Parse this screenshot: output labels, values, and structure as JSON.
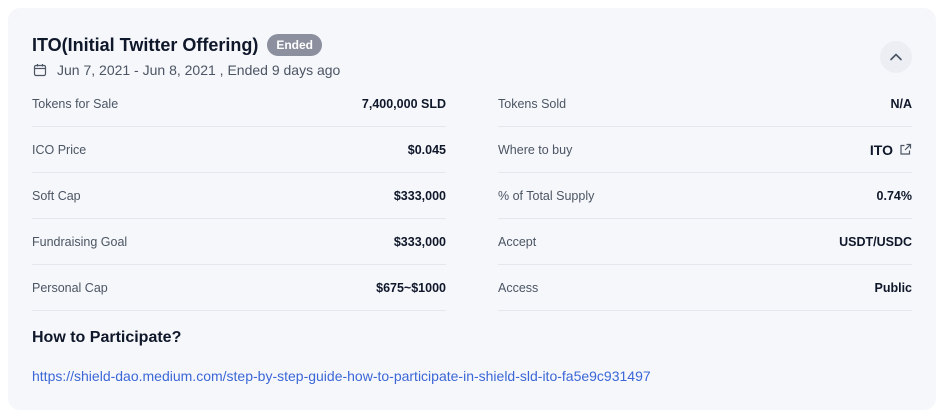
{
  "header": {
    "title": "ITO(Initial Twitter Offering)",
    "badge": "Ended",
    "date_text": "Jun 7, 2021 - Jun 8, 2021 , Ended 9 days ago"
  },
  "left_rows": [
    {
      "label": "Tokens for Sale",
      "value": "7,400,000 SLD"
    },
    {
      "label": "ICO Price",
      "value": "$0.045"
    },
    {
      "label": "Soft Cap",
      "value": "$333,000"
    },
    {
      "label": "Fundraising Goal",
      "value": "$333,000"
    },
    {
      "label": "Personal Cap",
      "value": "$675~$1000"
    }
  ],
  "right_rows": [
    {
      "label": "Tokens Sold",
      "value": "N/A"
    },
    {
      "label": "Where to buy",
      "value": "ITO"
    },
    {
      "label": "% of Total Supply",
      "value": "0.74%"
    },
    {
      "label": "Accept",
      "value": "USDT/USDC"
    },
    {
      "label": "Access",
      "value": "Public"
    }
  ],
  "how": {
    "heading": "How to Participate?",
    "url": "https://shield-dao.medium.com/step-by-step-guide-how-to-participate-in-shield-sld-ito-fa5e9c931497"
  },
  "icons": [
    "calendar-icon",
    "chevron-up-icon",
    "external-link-icon"
  ],
  "colors": {
    "badge": "#8b8f9e",
    "link": "#3b67d6",
    "card": "#f6f7fb"
  }
}
